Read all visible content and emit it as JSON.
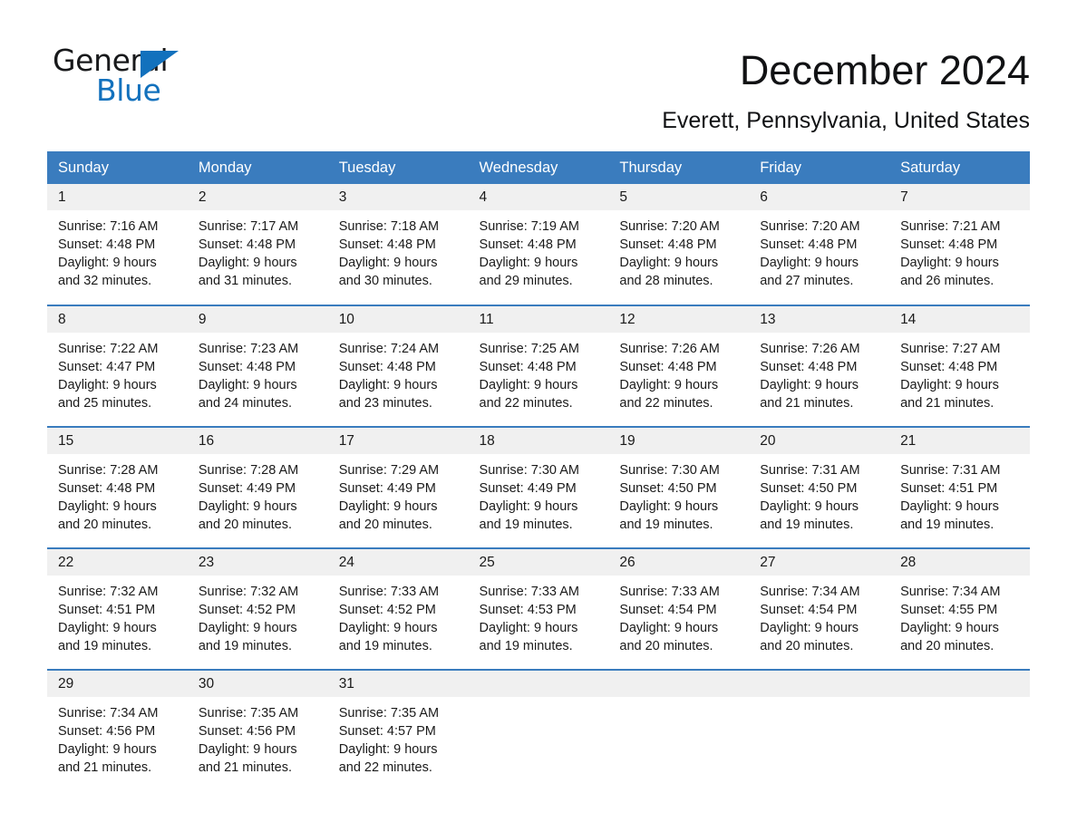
{
  "brand": {
    "word1": "General",
    "word2": "Blue",
    "accent_color": "#1271bd",
    "triangle_icon": "brand-triangle-icon"
  },
  "header": {
    "month_title": "December 2024",
    "location": "Everett, Pennsylvania, United States"
  },
  "calendar": {
    "header_bg": "#3a7cbe",
    "daynum_bg": "#f0f0f0",
    "weekday_headers": [
      "Sunday",
      "Monday",
      "Tuesday",
      "Wednesday",
      "Thursday",
      "Friday",
      "Saturday"
    ],
    "weeks": [
      [
        {
          "day": "1",
          "sunrise": "Sunrise: 7:16 AM",
          "sunset": "Sunset: 4:48 PM",
          "daylight_l1": "Daylight: 9 hours",
          "daylight_l2": "and 32 minutes."
        },
        {
          "day": "2",
          "sunrise": "Sunrise: 7:17 AM",
          "sunset": "Sunset: 4:48 PM",
          "daylight_l1": "Daylight: 9 hours",
          "daylight_l2": "and 31 minutes."
        },
        {
          "day": "3",
          "sunrise": "Sunrise: 7:18 AM",
          "sunset": "Sunset: 4:48 PM",
          "daylight_l1": "Daylight: 9 hours",
          "daylight_l2": "and 30 minutes."
        },
        {
          "day": "4",
          "sunrise": "Sunrise: 7:19 AM",
          "sunset": "Sunset: 4:48 PM",
          "daylight_l1": "Daylight: 9 hours",
          "daylight_l2": "and 29 minutes."
        },
        {
          "day": "5",
          "sunrise": "Sunrise: 7:20 AM",
          "sunset": "Sunset: 4:48 PM",
          "daylight_l1": "Daylight: 9 hours",
          "daylight_l2": "and 28 minutes."
        },
        {
          "day": "6",
          "sunrise": "Sunrise: 7:20 AM",
          "sunset": "Sunset: 4:48 PM",
          "daylight_l1": "Daylight: 9 hours",
          "daylight_l2": "and 27 minutes."
        },
        {
          "day": "7",
          "sunrise": "Sunrise: 7:21 AM",
          "sunset": "Sunset: 4:48 PM",
          "daylight_l1": "Daylight: 9 hours",
          "daylight_l2": "and 26 minutes."
        }
      ],
      [
        {
          "day": "8",
          "sunrise": "Sunrise: 7:22 AM",
          "sunset": "Sunset: 4:47 PM",
          "daylight_l1": "Daylight: 9 hours",
          "daylight_l2": "and 25 minutes."
        },
        {
          "day": "9",
          "sunrise": "Sunrise: 7:23 AM",
          "sunset": "Sunset: 4:48 PM",
          "daylight_l1": "Daylight: 9 hours",
          "daylight_l2": "and 24 minutes."
        },
        {
          "day": "10",
          "sunrise": "Sunrise: 7:24 AM",
          "sunset": "Sunset: 4:48 PM",
          "daylight_l1": "Daylight: 9 hours",
          "daylight_l2": "and 23 minutes."
        },
        {
          "day": "11",
          "sunrise": "Sunrise: 7:25 AM",
          "sunset": "Sunset: 4:48 PM",
          "daylight_l1": "Daylight: 9 hours",
          "daylight_l2": "and 22 minutes."
        },
        {
          "day": "12",
          "sunrise": "Sunrise: 7:26 AM",
          "sunset": "Sunset: 4:48 PM",
          "daylight_l1": "Daylight: 9 hours",
          "daylight_l2": "and 22 minutes."
        },
        {
          "day": "13",
          "sunrise": "Sunrise: 7:26 AM",
          "sunset": "Sunset: 4:48 PM",
          "daylight_l1": "Daylight: 9 hours",
          "daylight_l2": "and 21 minutes."
        },
        {
          "day": "14",
          "sunrise": "Sunrise: 7:27 AM",
          "sunset": "Sunset: 4:48 PM",
          "daylight_l1": "Daylight: 9 hours",
          "daylight_l2": "and 21 minutes."
        }
      ],
      [
        {
          "day": "15",
          "sunrise": "Sunrise: 7:28 AM",
          "sunset": "Sunset: 4:48 PM",
          "daylight_l1": "Daylight: 9 hours",
          "daylight_l2": "and 20 minutes."
        },
        {
          "day": "16",
          "sunrise": "Sunrise: 7:28 AM",
          "sunset": "Sunset: 4:49 PM",
          "daylight_l1": "Daylight: 9 hours",
          "daylight_l2": "and 20 minutes."
        },
        {
          "day": "17",
          "sunrise": "Sunrise: 7:29 AM",
          "sunset": "Sunset: 4:49 PM",
          "daylight_l1": "Daylight: 9 hours",
          "daylight_l2": "and 20 minutes."
        },
        {
          "day": "18",
          "sunrise": "Sunrise: 7:30 AM",
          "sunset": "Sunset: 4:49 PM",
          "daylight_l1": "Daylight: 9 hours",
          "daylight_l2": "and 19 minutes."
        },
        {
          "day": "19",
          "sunrise": "Sunrise: 7:30 AM",
          "sunset": "Sunset: 4:50 PM",
          "daylight_l1": "Daylight: 9 hours",
          "daylight_l2": "and 19 minutes."
        },
        {
          "day": "20",
          "sunrise": "Sunrise: 7:31 AM",
          "sunset": "Sunset: 4:50 PM",
          "daylight_l1": "Daylight: 9 hours",
          "daylight_l2": "and 19 minutes."
        },
        {
          "day": "21",
          "sunrise": "Sunrise: 7:31 AM",
          "sunset": "Sunset: 4:51 PM",
          "daylight_l1": "Daylight: 9 hours",
          "daylight_l2": "and 19 minutes."
        }
      ],
      [
        {
          "day": "22",
          "sunrise": "Sunrise: 7:32 AM",
          "sunset": "Sunset: 4:51 PM",
          "daylight_l1": "Daylight: 9 hours",
          "daylight_l2": "and 19 minutes."
        },
        {
          "day": "23",
          "sunrise": "Sunrise: 7:32 AM",
          "sunset": "Sunset: 4:52 PM",
          "daylight_l1": "Daylight: 9 hours",
          "daylight_l2": "and 19 minutes."
        },
        {
          "day": "24",
          "sunrise": "Sunrise: 7:33 AM",
          "sunset": "Sunset: 4:52 PM",
          "daylight_l1": "Daylight: 9 hours",
          "daylight_l2": "and 19 minutes."
        },
        {
          "day": "25",
          "sunrise": "Sunrise: 7:33 AM",
          "sunset": "Sunset: 4:53 PM",
          "daylight_l1": "Daylight: 9 hours",
          "daylight_l2": "and 19 minutes."
        },
        {
          "day": "26",
          "sunrise": "Sunrise: 7:33 AM",
          "sunset": "Sunset: 4:54 PM",
          "daylight_l1": "Daylight: 9 hours",
          "daylight_l2": "and 20 minutes."
        },
        {
          "day": "27",
          "sunrise": "Sunrise: 7:34 AM",
          "sunset": "Sunset: 4:54 PM",
          "daylight_l1": "Daylight: 9 hours",
          "daylight_l2": "and 20 minutes."
        },
        {
          "day": "28",
          "sunrise": "Sunrise: 7:34 AM",
          "sunset": "Sunset: 4:55 PM",
          "daylight_l1": "Daylight: 9 hours",
          "daylight_l2": "and 20 minutes."
        }
      ],
      [
        {
          "day": "29",
          "sunrise": "Sunrise: 7:34 AM",
          "sunset": "Sunset: 4:56 PM",
          "daylight_l1": "Daylight: 9 hours",
          "daylight_l2": "and 21 minutes."
        },
        {
          "day": "30",
          "sunrise": "Sunrise: 7:35 AM",
          "sunset": "Sunset: 4:56 PM",
          "daylight_l1": "Daylight: 9 hours",
          "daylight_l2": "and 21 minutes."
        },
        {
          "day": "31",
          "sunrise": "Sunrise: 7:35 AM",
          "sunset": "Sunset: 4:57 PM",
          "daylight_l1": "Daylight: 9 hours",
          "daylight_l2": "and 22 minutes."
        },
        {
          "day": "",
          "sunrise": "",
          "sunset": "",
          "daylight_l1": "",
          "daylight_l2": ""
        },
        {
          "day": "",
          "sunrise": "",
          "sunset": "",
          "daylight_l1": "",
          "daylight_l2": ""
        },
        {
          "day": "",
          "sunrise": "",
          "sunset": "",
          "daylight_l1": "",
          "daylight_l2": ""
        },
        {
          "day": "",
          "sunrise": "",
          "sunset": "",
          "daylight_l1": "",
          "daylight_l2": ""
        }
      ]
    ]
  }
}
